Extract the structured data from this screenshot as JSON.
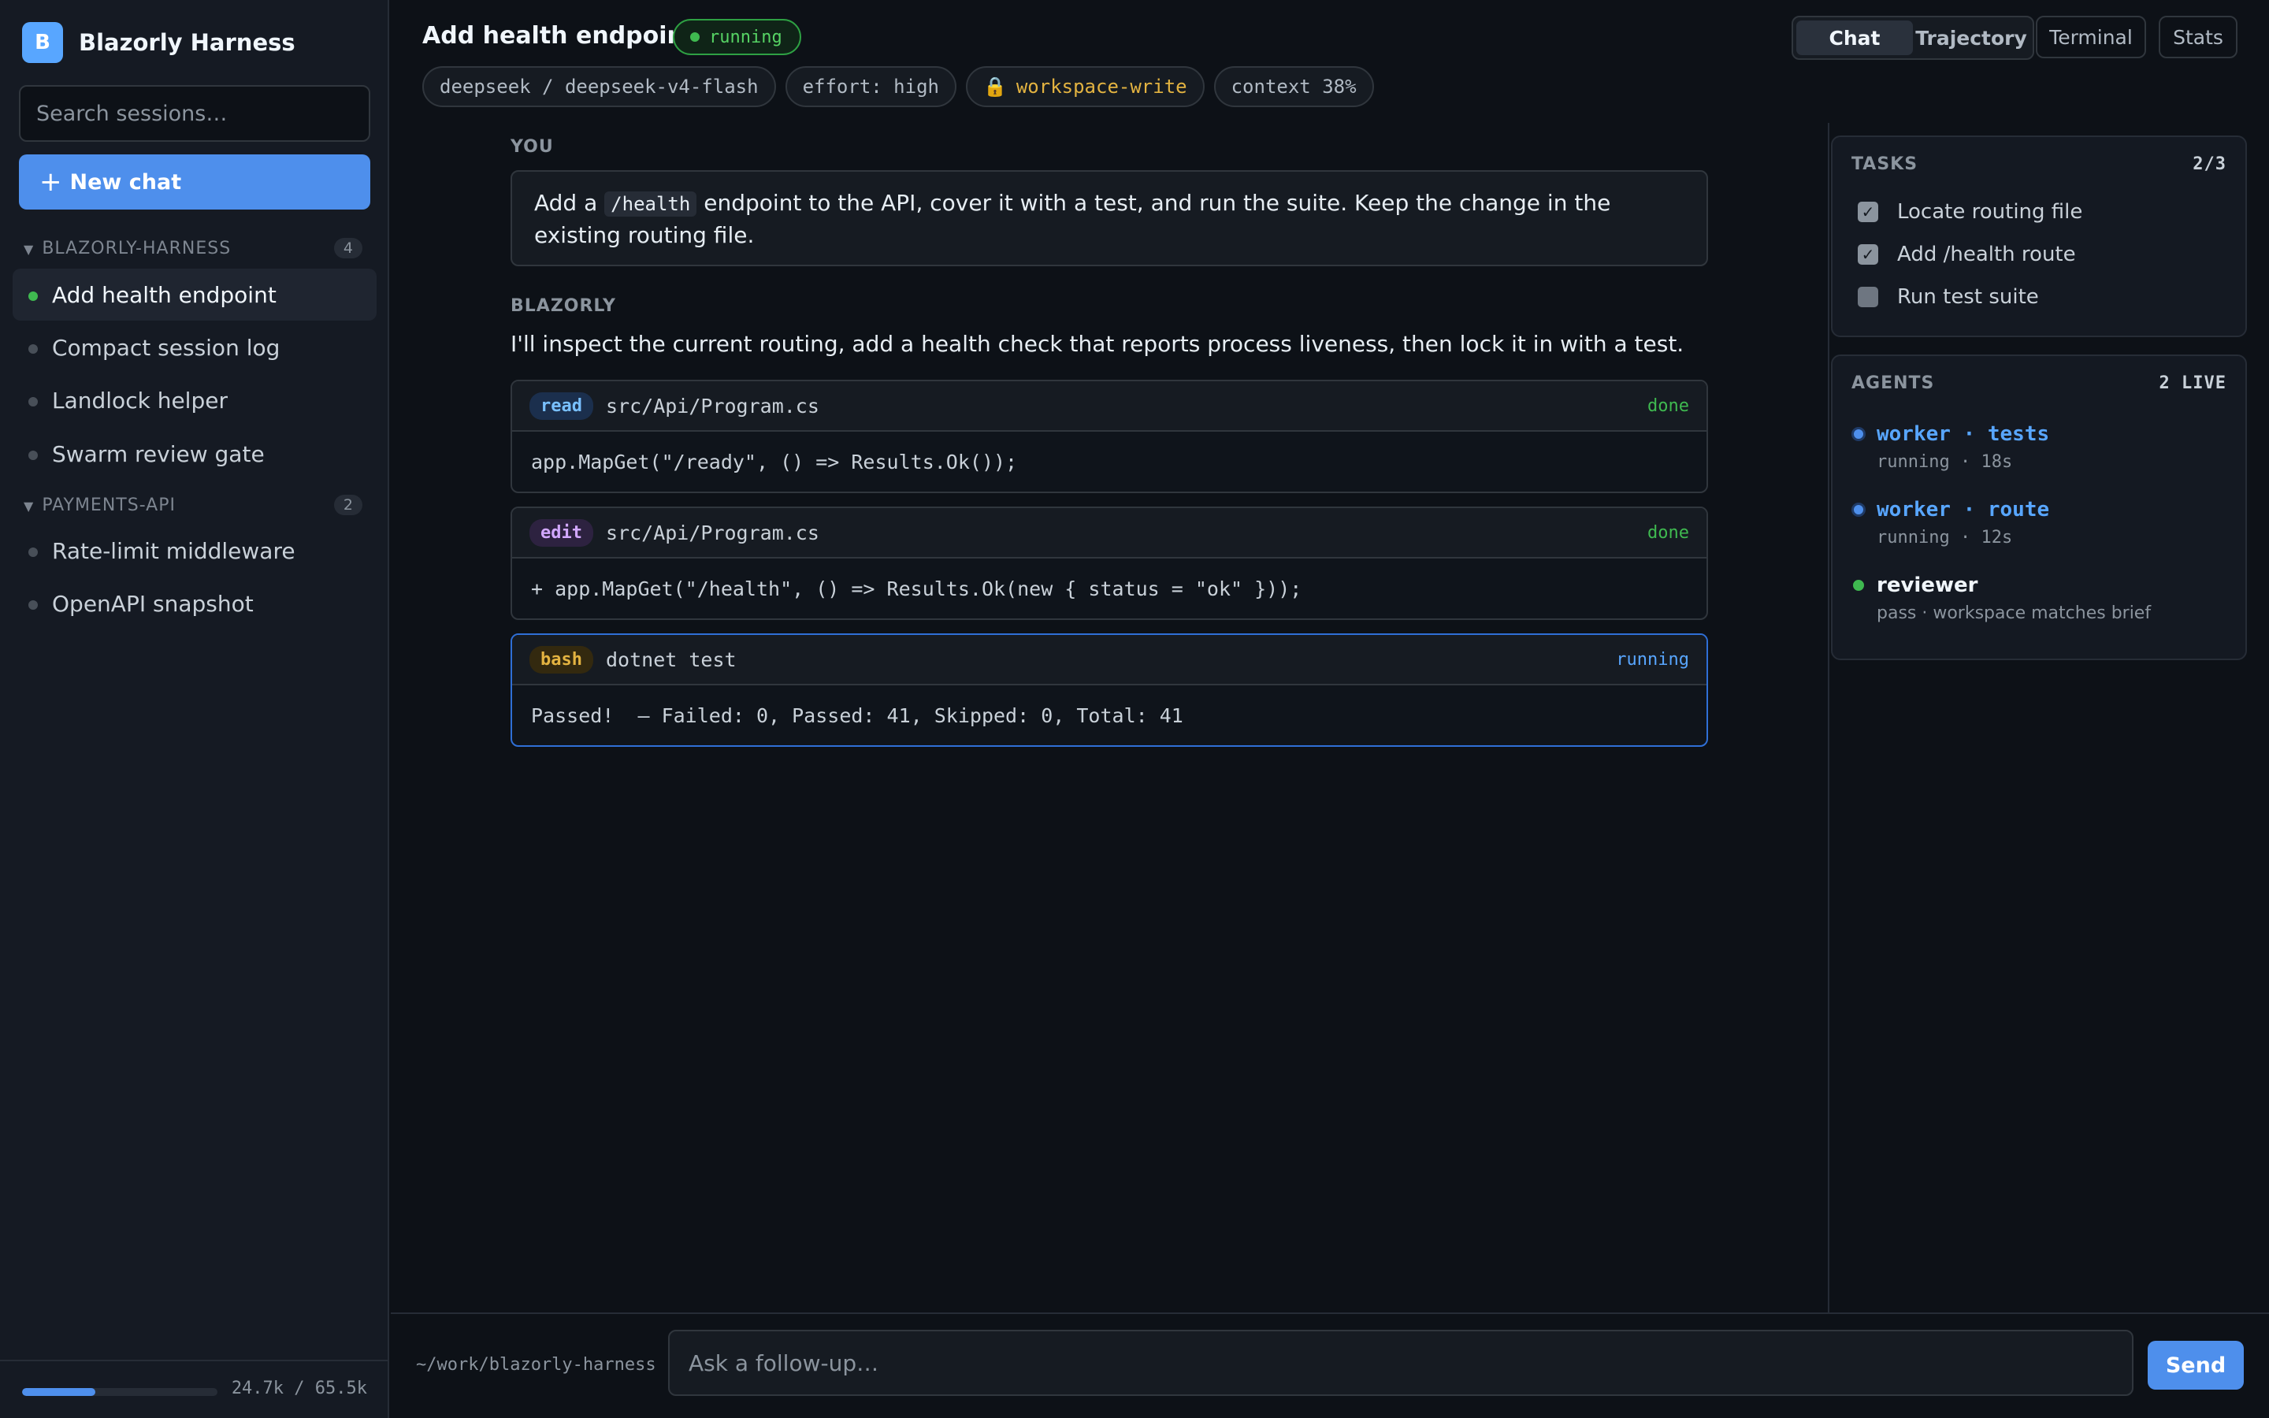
{
  "app": {
    "logo_letter": "B",
    "name": "Blazorly Harness"
  },
  "sidebar": {
    "search_placeholder": "Search sessions…",
    "new_chat_label": "New chat",
    "groups": [
      {
        "name": "BLAZORLY-HARNESS",
        "count": "4",
        "items": [
          {
            "label": "Add health endpoint",
            "active": true
          },
          {
            "label": "Compact session log"
          },
          {
            "label": "Landlock helper"
          },
          {
            "label": "Swarm review gate"
          }
        ]
      },
      {
        "name": "PAYMENTS-API",
        "count": "2",
        "items": [
          {
            "label": "Rate-limit middleware"
          },
          {
            "label": "OpenAPI snapshot"
          }
        ]
      }
    ],
    "usage": {
      "text": "24.7k / 65.5k",
      "fraction": 0.377
    }
  },
  "header": {
    "title": "Add health endpoint",
    "status": "running",
    "chips": [
      "deepseek / deepseek-v4-flash",
      "effort: high",
      "workspace-write",
      "context 38%"
    ],
    "tabs": [
      "Chat",
      "Trajectory"
    ],
    "active_tab": "Chat",
    "buttons": [
      "Terminal",
      "Stats"
    ]
  },
  "conversation": {
    "user_role": "YOU",
    "user_message": {
      "before": "Add a ",
      "code": "/health",
      "after": " endpoint to the API, cover it with a test, and run the suite. Keep the change in the existing routing file."
    },
    "assistant_role": "BLAZORLY",
    "assistant_message": "I'll inspect the current routing, add a health check that reports process liveness, then lock it in with a test.",
    "tools": [
      {
        "tag": "read",
        "path": "src/Api/Program.cs",
        "status": "done",
        "output": "app.MapGet(\"/ready\", () => Results.Ok());"
      },
      {
        "tag": "edit",
        "path": "src/Api/Program.cs",
        "status": "done",
        "output": "+ app.MapGet(\"/health\", () => Results.Ok(new { status = \"ok\" }));"
      },
      {
        "tag": "bash",
        "path": "dotnet test",
        "status": "running",
        "output": "Passed!  — Failed: 0, Passed: 41, Skipped: 0, Total: 41"
      }
    ]
  },
  "tasks": {
    "title": "TASKS",
    "count": "2/3",
    "items": [
      {
        "label": "Locate routing file",
        "done": true
      },
      {
        "label": "Add /health route",
        "done": true
      },
      {
        "label": "Run test suite",
        "done": false
      }
    ]
  },
  "agents": {
    "title": "AGENTS",
    "count": "2 LIVE",
    "items": [
      {
        "name": "worker · tests",
        "sub": "running · 18s"
      },
      {
        "name": "worker · route",
        "sub": "running · 12s"
      },
      {
        "name": "reviewer",
        "sub": "pass · workspace matches brief"
      }
    ]
  },
  "composer": {
    "cwd": "~/work/blazorly-harness",
    "placeholder": "Ask a follow-up…",
    "send_label": "Send"
  },
  "colors": {
    "accent": "#4e8fec",
    "running": "#3fb950",
    "warning": "#e3b341"
  }
}
